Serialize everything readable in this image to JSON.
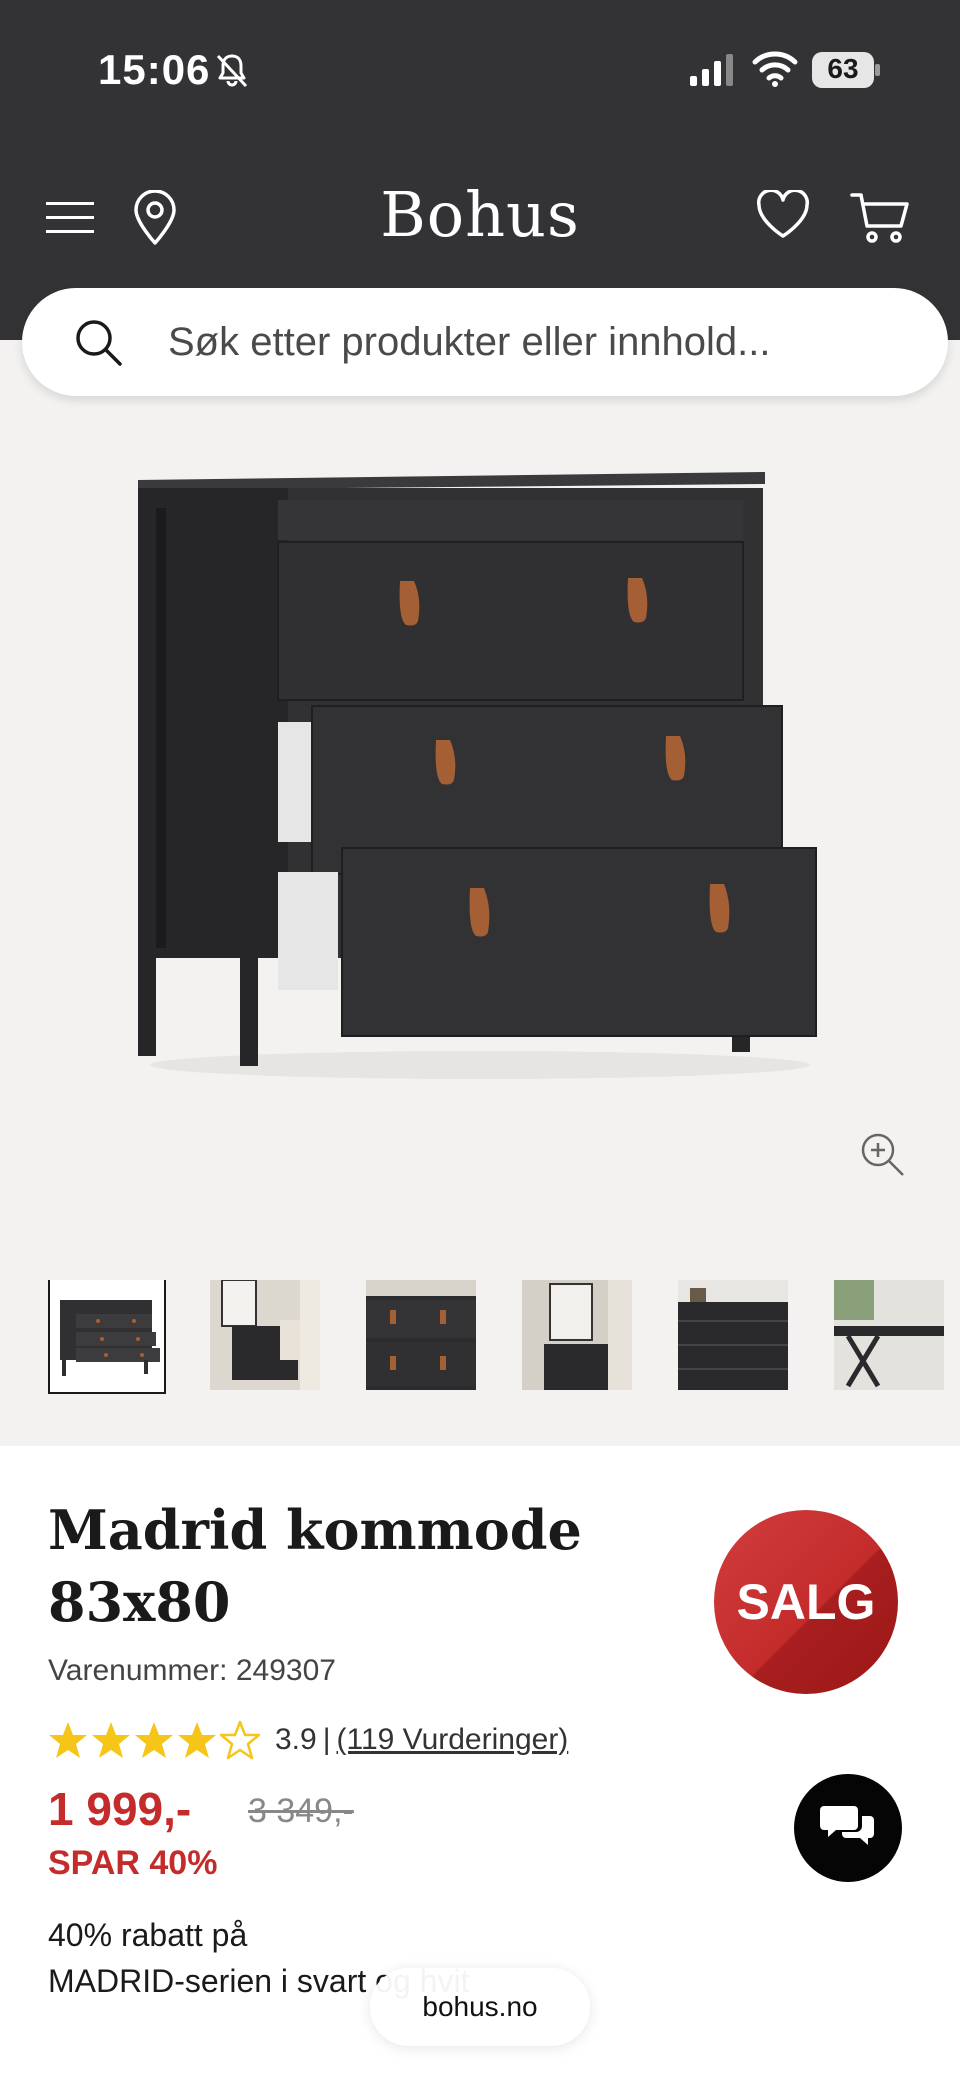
{
  "status_bar": {
    "time": "15:06",
    "battery": "63"
  },
  "header": {
    "brand": "Bohus"
  },
  "search": {
    "placeholder": "Søk etter produkter eller innhold..."
  },
  "product": {
    "title_line1": "Madrid kommode",
    "title_line2": "83x80",
    "sku_label": "Varenummer:",
    "sku": "249307",
    "badge": "SALG",
    "rating_value": "3.9",
    "rating_separator": "|",
    "rating_count": "(119 Vurderinger)",
    "rating_stars": 3.9,
    "price": "1 999,-",
    "old_price": "3 349,-",
    "savings": "SPAR 40%",
    "promo_line1": "40% rabatt på",
    "promo_line2": "MADRID-serien i svart og hvit"
  },
  "browser": {
    "url": "bohus.no"
  },
  "colors": {
    "header_bg": "#333336",
    "sale_red": "#c42c2c",
    "star_yellow": "#f5c518"
  }
}
